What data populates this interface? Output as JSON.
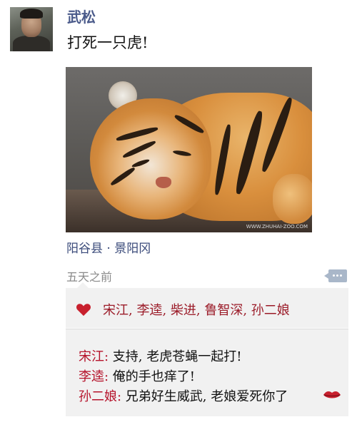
{
  "post": {
    "author": "武松",
    "text": "打死一只虎!",
    "location": "阳谷县 · 景阳冈",
    "time": "五天之前"
  },
  "photo": {
    "subject": "sleeping-tiger",
    "watermark": "WWW.ZHUHAI-ZOO.COM"
  },
  "likes": {
    "text": "宋江, 李逵, 柴进, 鲁智深, 孙二娘",
    "icon": "heart-icon",
    "color": "#c8202e"
  },
  "comments": [
    {
      "name": "宋江:",
      "text": " 支持, 老虎苍蝇一起打!"
    },
    {
      "name": "李逵:",
      "text": " 俺的手也痒了!"
    },
    {
      "name": "孙二娘:",
      "text": " 兄弟好生威武, 老娘爱死你了"
    }
  ],
  "colors": {
    "author": "#4a5a8a",
    "comment_name": "#b5122a",
    "panel": "#f1f1f1"
  }
}
